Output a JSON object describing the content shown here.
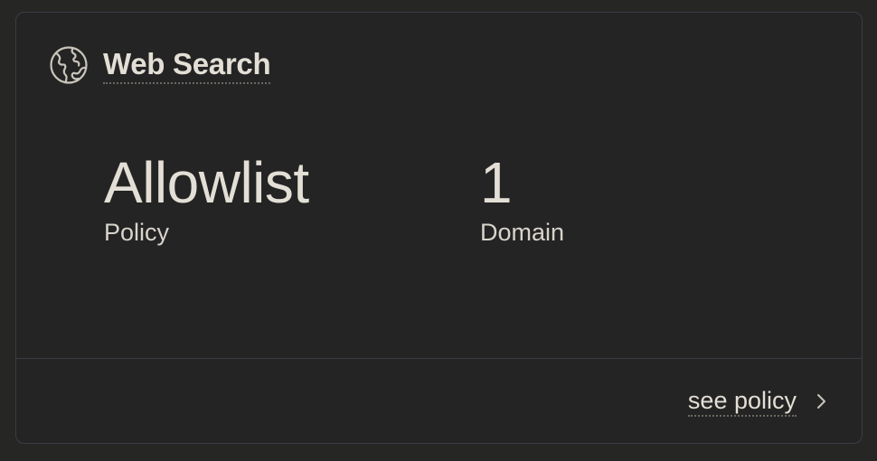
{
  "card": {
    "title": "Web Search",
    "icon": "globe-icon",
    "stats": [
      {
        "value": "Allowlist",
        "label": "Policy"
      },
      {
        "value": "1",
        "label": "Domain"
      }
    ],
    "footer": {
      "link_label": "see policy",
      "link_icon": "chevron-right-icon"
    }
  },
  "colors": {
    "background": "#262625",
    "card_background": "#242424",
    "border": "#3a3d44",
    "text": "#e3dfd6"
  }
}
